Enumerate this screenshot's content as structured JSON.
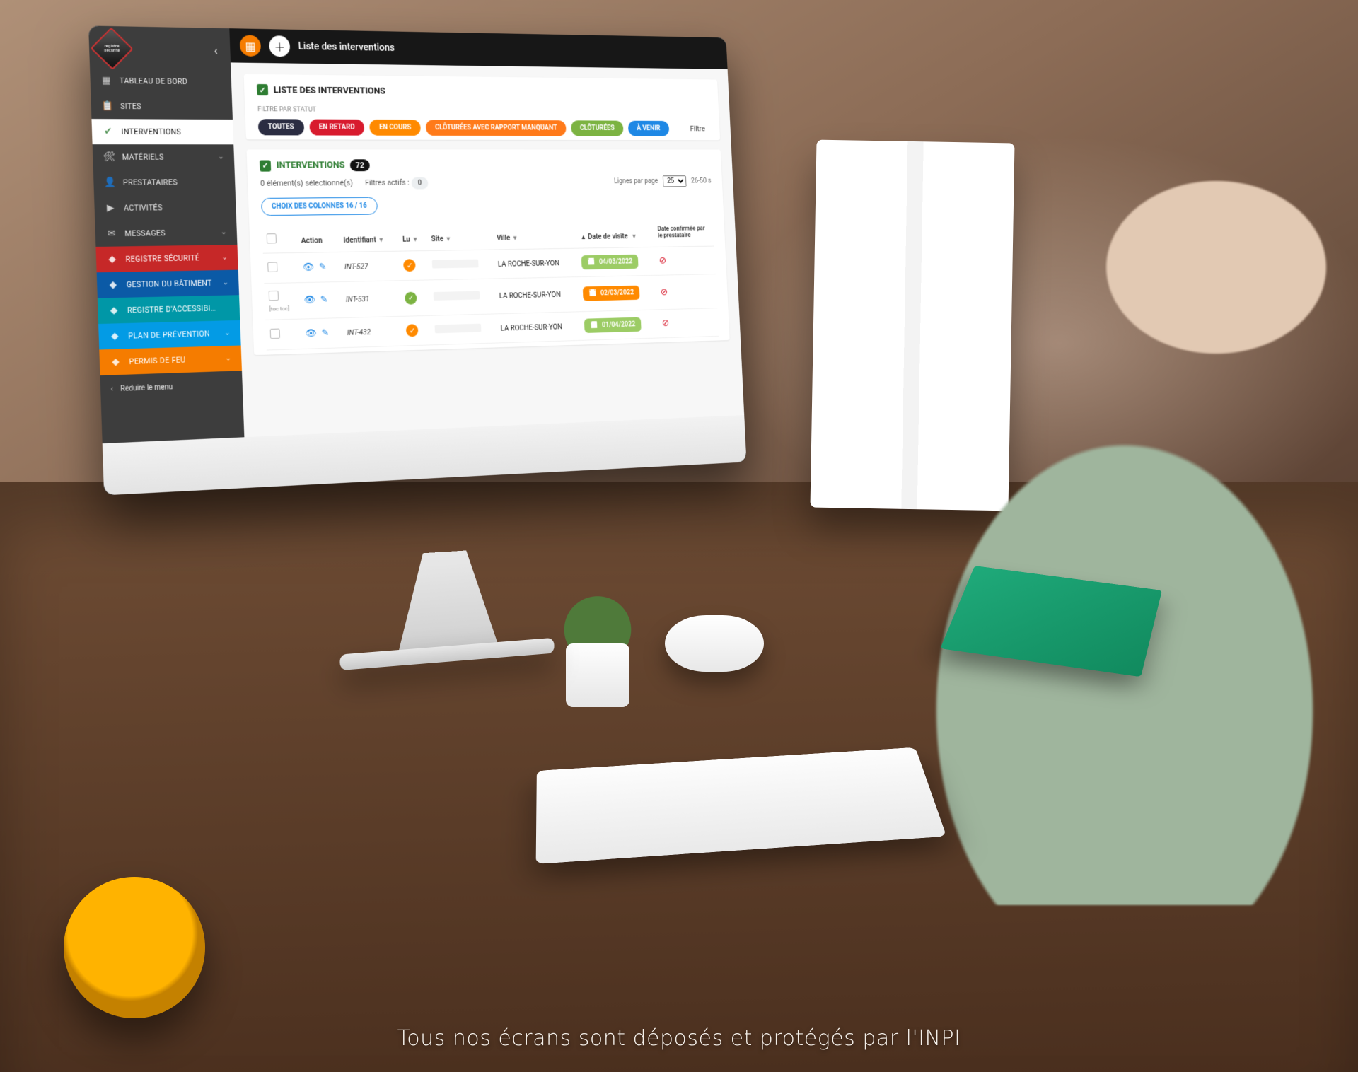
{
  "banner": "Tous nos écrans sont déposés et protégés par l'INPI",
  "logo_text": "registre\nsécurité",
  "topbar": {
    "title": "Liste des interventions"
  },
  "sidebar": {
    "items": [
      {
        "icon": "▦",
        "label": "TABLEAU DE BORD",
        "active": false
      },
      {
        "icon": "📋",
        "label": "SITES",
        "active": false
      },
      {
        "icon": "✔",
        "label": "INTERVENTIONS",
        "active": true
      },
      {
        "icon": "🛠",
        "label": "MATÉRIELS",
        "active": false,
        "expandable": true
      },
      {
        "icon": "👤",
        "label": "PRESTATAIRES",
        "active": false
      },
      {
        "icon": "▶",
        "label": "ACTIVITÉS",
        "active": false
      },
      {
        "icon": "✉",
        "label": "MESSAGES",
        "active": false,
        "expandable": true
      },
      {
        "icon": "◆",
        "label": "REGISTRE SÉCURITÉ",
        "accent": "red",
        "expandable": true
      },
      {
        "icon": "◆",
        "label": "GESTION DU BÂTIMENT",
        "accent": "blue",
        "expandable": true
      },
      {
        "icon": "◆",
        "label": "REGISTRE D'ACCESSIBI…",
        "accent": "teal"
      },
      {
        "icon": "◆",
        "label": "PLAN DE PRÉVENTION",
        "accent": "cyan",
        "expandable": true
      },
      {
        "icon": "◆",
        "label": "PERMIS DE FEU",
        "accent": "orange",
        "expandable": true
      }
    ],
    "reduce": "Réduire le menu"
  },
  "listPanel": {
    "title": "LISTE DES INTERVENTIONS",
    "filter_label": "FILTRE PAR STATUT",
    "chips": {
      "toutes": "TOUTES",
      "retard": "EN RETARD",
      "cours": "EN COURS",
      "rapport": "CLÔTURÉES AVEC RAPPORT MANQUANT",
      "clot": "CLÔTURÉES",
      "avenir": "À VENIR"
    },
    "filtre_btn": "Filtre"
  },
  "interPanel": {
    "title": "INTERVENTIONS",
    "count": "72",
    "selection_text": "0 élément(s) sélectionné(s)",
    "filtres_actifs_label": "Filtres actifs :",
    "filtres_actifs_count": "0",
    "lignes_label": "Lignes par page",
    "lignes_value": "25",
    "range": "26-50 s",
    "col_choice": "CHOIX DES COLONNES 16 / 16",
    "cols": {
      "action": "Action",
      "identifiant": "Identifiant",
      "lu": "Lu",
      "site": "Site",
      "ville": "Ville",
      "date_visite": "Date de visite",
      "date_conf": "Date confirmée par le prestataire"
    },
    "rows": [
      {
        "ident": "INT-527",
        "lu": "orange",
        "ville": "LA ROCHE-SUR-YON",
        "date": "04/03/2022",
        "date_color": "green",
        "conf": "x",
        "toc": ""
      },
      {
        "ident": "INT-531",
        "lu": "green",
        "ville": "LA ROCHE-SUR-YON",
        "date": "02/03/2022",
        "date_color": "orange",
        "conf": "x",
        "toc": "[toc toc]"
      },
      {
        "ident": "INT-432",
        "lu": "orange",
        "ville": "LA ROCHE-SUR-YON",
        "date": "01/04/2022",
        "date_color": "green",
        "conf": "x",
        "toc": ""
      }
    ]
  }
}
